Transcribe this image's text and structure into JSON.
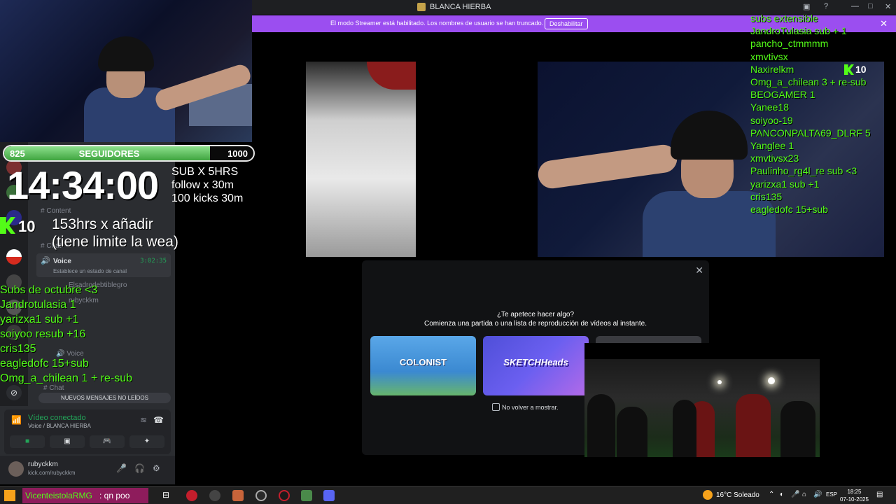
{
  "window": {
    "title": "BLANCA HIERBA",
    "controls": [
      "minimize",
      "maximize",
      "close"
    ]
  },
  "streamer_banner": {
    "message": "El modo Streamer está habilitado. Los nombres de usuario se han truncado.",
    "button": "Deshabilitar"
  },
  "webcam_overlay": {
    "followers_current": "825",
    "followers_label": "SEGUIDORES",
    "followers_goal": "1000",
    "followers_progress": 0.825,
    "timer": "14:34:00",
    "sub_rules": [
      "SUB X 5HRS",
      "follow x 30m",
      "100 kicks 30m"
    ],
    "hours_text": [
      "153hrs  x añadir",
      "(tiene limite la wea)"
    ],
    "kick_count": "10"
  },
  "subs_list": [
    "Subs de octubre <3",
    "Jandrotulasia 1",
    "yarizxa1 sub +1",
    "soiyoo resub +16",
    "cris135",
    "eagledofc 15+sub",
    "Omg_a_chilean 1 + re-sub"
  ],
  "chat_overlay": [
    "subs extensible",
    "JandroTulasia sub + 1",
    "pancho_ctmmmm",
    "xmvtivsx",
    "Naxirelkm",
    "Omg_a_chilean 3 + re-sub",
    "BEOGAMER 1",
    "Yanee18",
    "soiyoo-19",
    "PANCONPALTA69_DLRF 5",
    "Yanglee 1",
    "xmvtivsx23",
    "Paulinho_rg4l_re sub <3",
    "yarizxa1 sub +1",
    "cris135",
    "eagledofc 15+sub"
  ],
  "stream_kick_count": "10",
  "sidebar": {
    "channels": [
      {
        "icon": "#",
        "name": "Content"
      },
      {
        "icon": "#",
        "name": "Chat"
      }
    ],
    "voice_channel": {
      "name": "Voice",
      "time": "3:02:35",
      "status": "Establece un estado de canal"
    },
    "voice_members": [
      "Elsadrodebtiblegro",
      "rubyckkm"
    ],
    "voice_2": "Voice",
    "chat_2": "Chat",
    "voice_3": "Voice",
    "new_messages": "NUEVOS MENSAJES NO LEÍDOS"
  },
  "voice_connected": {
    "title": "Vídeo conectado",
    "location": "Voice / BLANCA HIERBA"
  },
  "user": {
    "name": "rubyckkm",
    "status": "kick.com/rubyckkm"
  },
  "activity": {
    "question": "¿Te apetece hacer algo?",
    "subtitle": "Comienza una partida o una lista de reproducción de vídeos al instante.",
    "cards": [
      "COLONIST",
      "SKETCHHeads"
    ],
    "no_show": "No volver a mostrar."
  },
  "taskbar": {
    "ticker_green": "VicenteistolaRMG",
    "ticker_white": ": qn poo",
    "weather": "16°C  Soleado",
    "lang": "ESP",
    "time": "18:25",
    "date": "07-10-2025",
    "badge": "3"
  },
  "colors": {
    "kick_green": "#53fc18",
    "discord_bg": "#2b2d31",
    "streamer_purple": "#9b4ef0"
  }
}
